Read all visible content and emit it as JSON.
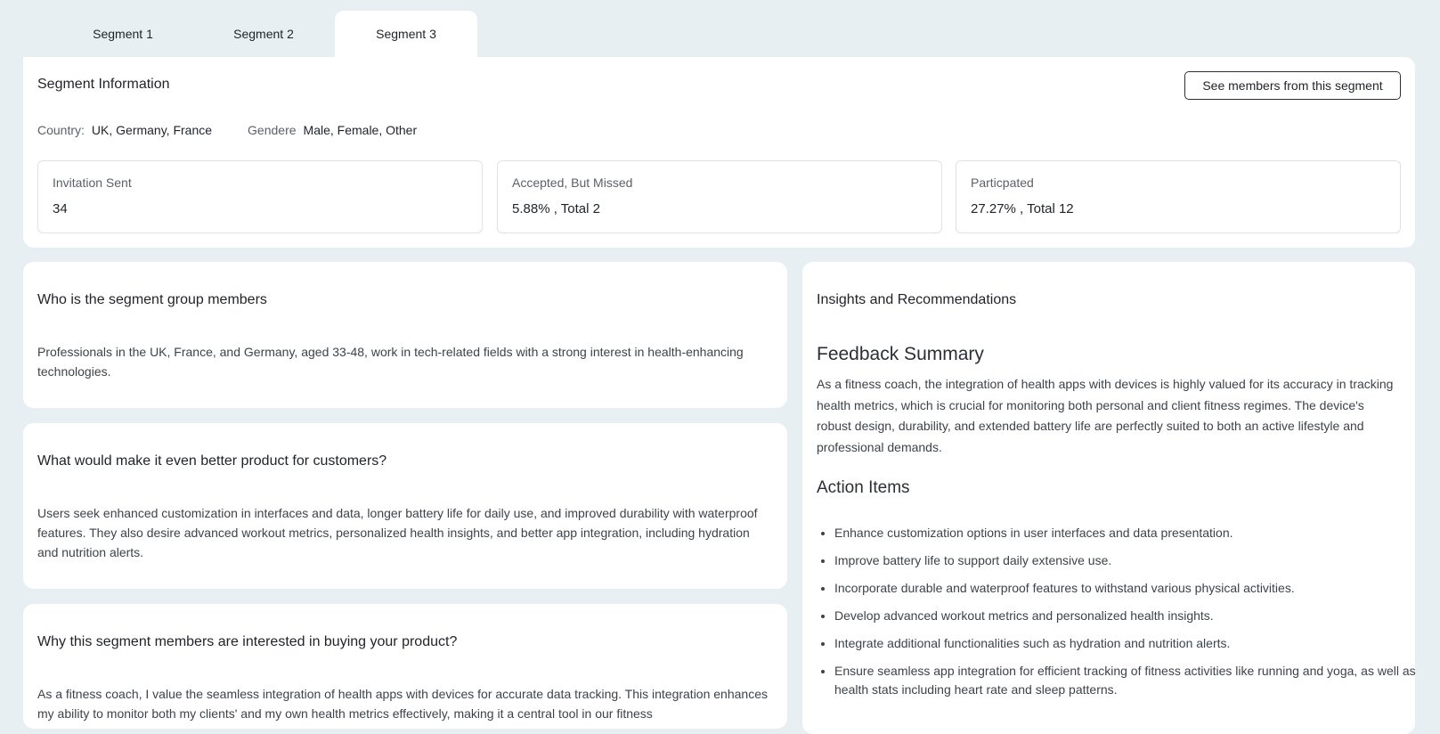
{
  "tabs": [
    "Segment 1",
    "Segment 2",
    "Segment 3"
  ],
  "segment_info": {
    "title": "Segment Information",
    "members_button": "See members from this segment",
    "country_label": "Country:",
    "country_value": "UK, Germany, France",
    "gender_label": "Gendere",
    "gender_value": "Male, Female, Other",
    "stats": [
      {
        "label": "Invitation Sent",
        "value": "34"
      },
      {
        "label": "Accepted, But Missed",
        "value": "5.88% , Total 2"
      },
      {
        "label": "Particpated",
        "value": "27.27% , Total 12"
      }
    ]
  },
  "who": {
    "title": "Who is the segment group members",
    "body": "Professionals in the UK, France, and Germany, aged 33-48, work in tech-related fields with a strong interest in health-enhancing technologies."
  },
  "better": {
    "title": "What would make it even better product for customers?",
    "body": "Users seek enhanced customization in interfaces and data, longer battery life for daily use, and improved durability with waterproof features. They also desire advanced workout metrics, personalized health insights, and better app integration, including hydration and nutrition alerts."
  },
  "why": {
    "title": "Why this segment members are interested in buying your product?",
    "body": "As a fitness coach, I value the seamless integration of health apps with devices for accurate data tracking. This integration enhances my ability to monitor both my clients' and my own health metrics effectively, making it a central tool in our fitness"
  },
  "insights": {
    "title": "Insights and Recommendations",
    "summary_heading": "Feedback Summary",
    "summary_text": "As a fitness coach, the integration of health apps with devices is highly valued for its accuracy in tracking health metrics, which is crucial for monitoring both personal and client fitness regimes. The device's robust design, durability, and extended battery life are perfectly suited to both an active lifestyle and professional demands.",
    "actions_heading": "Action Items",
    "actions": [
      "Enhance customization options in user interfaces and data presentation.",
      "Improve battery life to support daily extensive use.",
      "Incorporate durable and waterproof features to withstand various physical activities.",
      "Develop advanced workout metrics and personalized health insights.",
      "Integrate additional functionalities such as hydration and nutrition alerts.",
      "Ensure seamless app integration for efficient tracking of fitness activities like running and yoga, as well as health stats including heart rate and sleep patterns."
    ]
  }
}
